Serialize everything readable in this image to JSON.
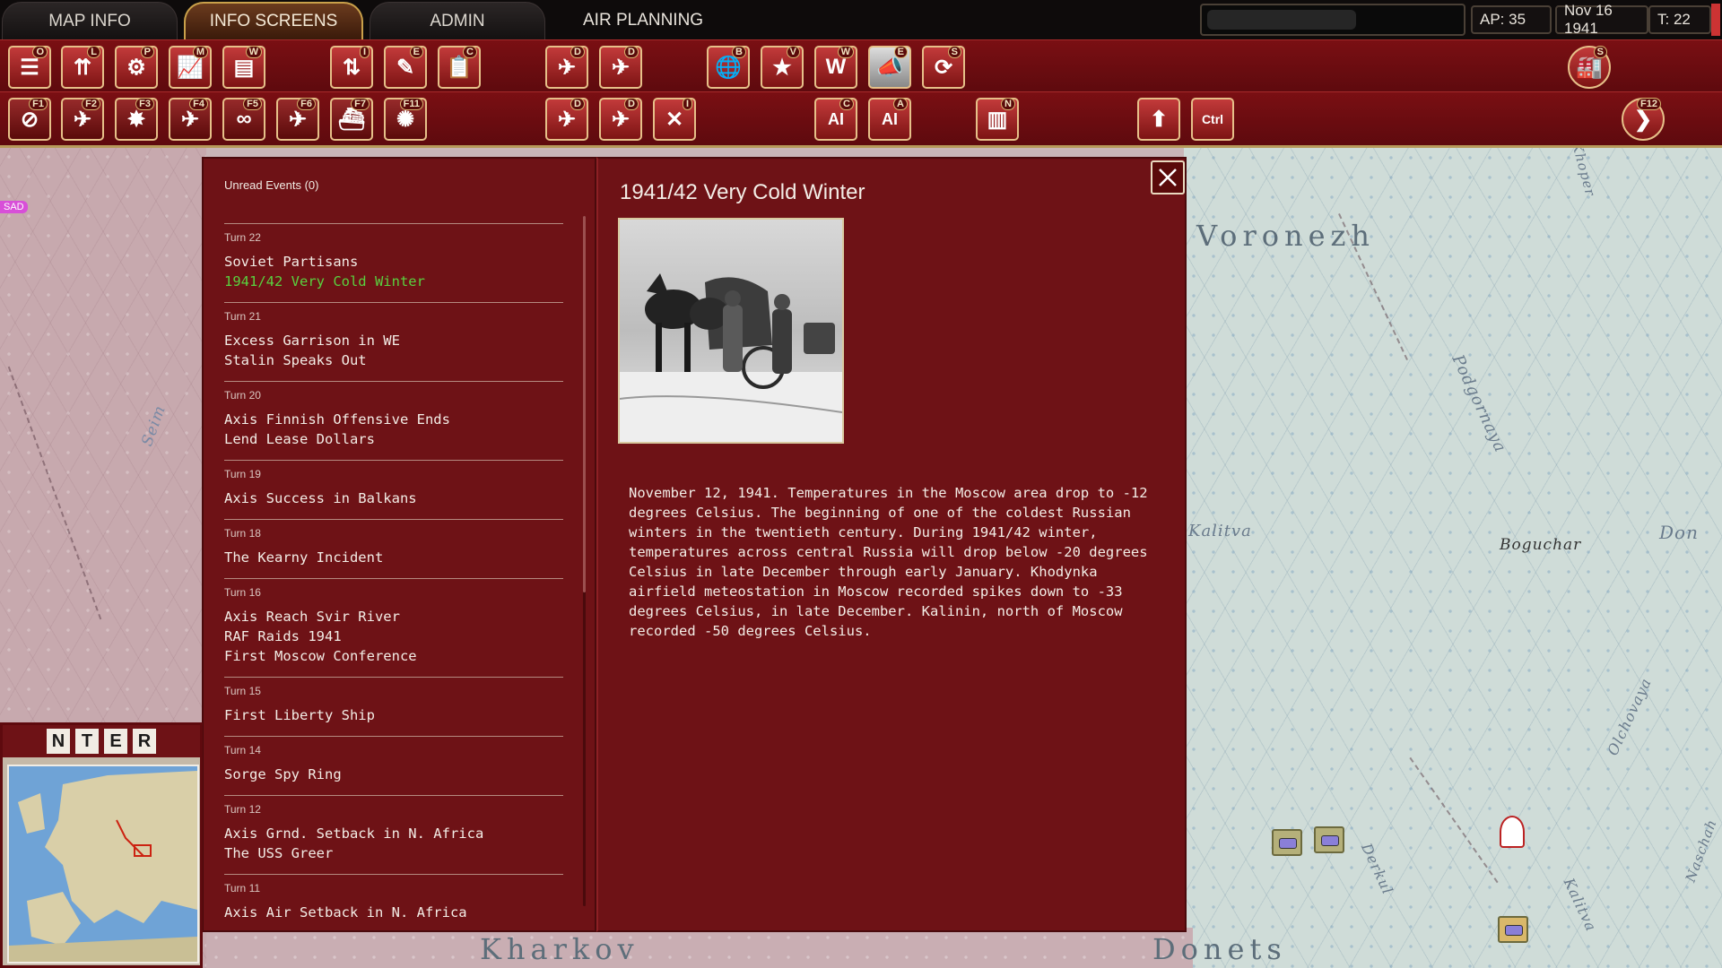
{
  "topbar": {
    "tabs": [
      {
        "label": "MAP INFO"
      },
      {
        "label": "INFO SCREENS"
      },
      {
        "label": "ADMIN"
      }
    ],
    "air_planning": "AIR PLANNING",
    "ap": "AP: 35",
    "date": "Nov 16 1941",
    "turn": "T: 22"
  },
  "toolbar_row1": [
    {
      "icon": "list-icon",
      "key": "O"
    },
    {
      "icon": "unit-strength-icon",
      "key": "L"
    },
    {
      "icon": "gear-icon",
      "key": "P"
    },
    {
      "icon": "chart-icon",
      "key": "M"
    },
    {
      "icon": "report-icon",
      "key": "W"
    },
    {
      "icon": "swap-arrows-icon",
      "key": "I"
    },
    {
      "icon": "event-document-icon",
      "key": "E"
    },
    {
      "icon": "clipboard-icon",
      "key": "C"
    },
    {
      "icon": "air-document-icon",
      "key": "D"
    },
    {
      "icon": "air-list-icon",
      "key": "D"
    },
    {
      "icon": "globe-report-icon",
      "key": "B"
    },
    {
      "icon": "star-icon",
      "key": "V"
    },
    {
      "icon": "w-document-icon",
      "key": "W"
    },
    {
      "icon": "megaphone-icon",
      "key": "E"
    },
    {
      "icon": "refresh-document-icon",
      "key": "S"
    },
    {
      "icon": "factory-round-icon",
      "key": "S"
    }
  ],
  "toolbar_row2": [
    {
      "icon": "no-air-icon",
      "key": "F1"
    },
    {
      "icon": "naval-air-icon",
      "key": "F2"
    },
    {
      "icon": "bombing-icon",
      "key": "F3"
    },
    {
      "icon": "air-city-icon",
      "key": "F4"
    },
    {
      "icon": "air-recon-icon",
      "key": "F5"
    },
    {
      "icon": "air-superiority-icon",
      "key": "F6"
    },
    {
      "icon": "naval-ship-icon",
      "key": "F7"
    },
    {
      "icon": "explosion-icon",
      "key": "F11"
    },
    {
      "icon": "air-document-icon",
      "key": "D"
    },
    {
      "icon": "air-list-icon",
      "key": "D"
    },
    {
      "icon": "air-intercept-icon",
      "key": "I"
    },
    {
      "icon": "ai-city-icon",
      "key": "C"
    },
    {
      "icon": "ai-air-icon",
      "key": "A"
    },
    {
      "icon": "factory-document-icon",
      "key": "N"
    },
    {
      "icon": "up-arrow-icon",
      "key": ""
    },
    {
      "icon": "ctrl-icon",
      "key": ""
    },
    {
      "icon": "next-turn-icon",
      "key": "F12"
    }
  ],
  "events": {
    "unread_label": "Unread Events (0)",
    "groups": [
      {
        "turn": "Turn 22",
        "items": [
          "Soviet Partisans",
          "1941/42 Very Cold Winter"
        ],
        "selected": 1
      },
      {
        "turn": "Turn 21",
        "items": [
          "Excess Garrison in WE",
          "Stalin Speaks Out"
        ],
        "selected": -1
      },
      {
        "turn": "Turn 20",
        "items": [
          "Axis Finnish Offensive Ends",
          "Lend Lease Dollars"
        ],
        "selected": -1
      },
      {
        "turn": "Turn 19",
        "items": [
          "Axis Success in Balkans"
        ],
        "selected": -1
      },
      {
        "turn": "Turn 18",
        "items": [
          "The Kearny Incident"
        ],
        "selected": -1
      },
      {
        "turn": "Turn 16",
        "items": [
          "Axis Reach Svir River",
          "RAF Raids 1941",
          "First Moscow Conference"
        ],
        "selected": -1
      },
      {
        "turn": "Turn 15",
        "items": [
          "First Liberty Ship"
        ],
        "selected": -1
      },
      {
        "turn": "Turn 14",
        "items": [
          "Sorge Spy Ring"
        ],
        "selected": -1
      },
      {
        "turn": "Turn 12",
        "items": [
          "Axis Grnd. Setback in N. Africa",
          "The USS Greer"
        ],
        "selected": -1
      },
      {
        "turn": "Turn 11",
        "items": [
          "Axis Air Setback in N. Africa"
        ],
        "selected": -1
      }
    ],
    "detail_title": "1941/42 Very Cold Winter",
    "detail_body": "November 12, 1941. Temperatures in the Moscow area drop to -12 degrees Celsius. The beginning of one of the coldest Russian winters in the twentieth century. During 1941/42 winter, temperatures across central Russia will drop below -20 degrees Celsius in late December through early January. Khodynka airfield meteostation in Moscow recorded spikes down to -33 degrees Celsius, in late December. Kalinin, north of Moscow recorded -50 degrees Celsius."
  },
  "map": {
    "labels": [
      "Voronezh",
      "Kharkov",
      "Donets",
      "Boguchar",
      "Don",
      "Podgornaya",
      "Olchovaya",
      "Derkul",
      "Kalitva",
      "Seim",
      "Kalitva",
      "Naschah",
      "Khoper",
      "SAD"
    ]
  },
  "minimap": {
    "letters": [
      "N",
      "T",
      "E",
      "R"
    ]
  },
  "colors": {
    "panel": "#6e1216",
    "toolbar": "#7a0f13",
    "selected_event": "#59d13f",
    "accent_gold": "#c9a04a"
  }
}
